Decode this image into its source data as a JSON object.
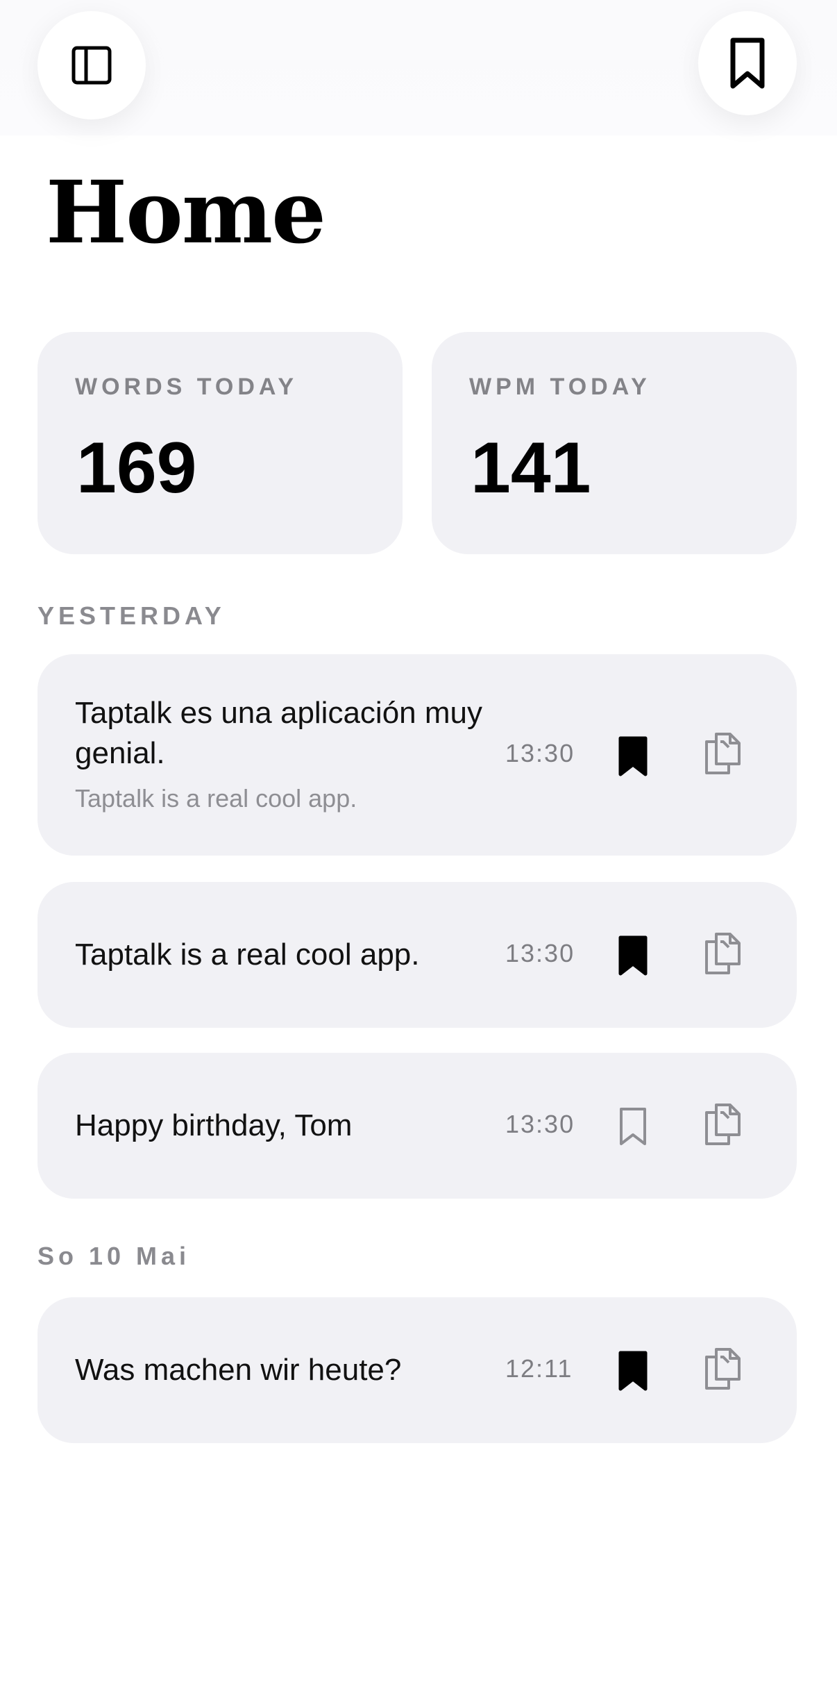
{
  "header": {
    "sidebar_icon": "sidebar-toggle-icon",
    "bookmarks_icon": "bookmark-icon"
  },
  "page": {
    "title": "Home"
  },
  "stats": [
    {
      "label": "WORDS TODAY",
      "value": "169"
    },
    {
      "label": "WPM TODAY",
      "value": "141"
    }
  ],
  "sections": [
    {
      "title": "YESTERDAY",
      "entries": [
        {
          "text": "Taptalk es una aplicación muy genial.",
          "translation": "Taptalk is a real cool app.",
          "time": "13:30",
          "bookmarked": true
        },
        {
          "text": "Taptalk is a real cool app.",
          "time": "13:30",
          "bookmarked": true
        },
        {
          "text": "Happy birthday, Tom",
          "time": "13:30",
          "bookmarked": false
        }
      ]
    },
    {
      "title": "So 10 Mai",
      "entries": [
        {
          "text": "Was machen wir heute?",
          "time": "12:11",
          "bookmarked": true
        }
      ]
    }
  ],
  "colors": {
    "card_background": "#f1f1f5",
    "label_gray": "#838388",
    "icon_dark": "#000000",
    "icon_gray": "#8e8e93"
  }
}
